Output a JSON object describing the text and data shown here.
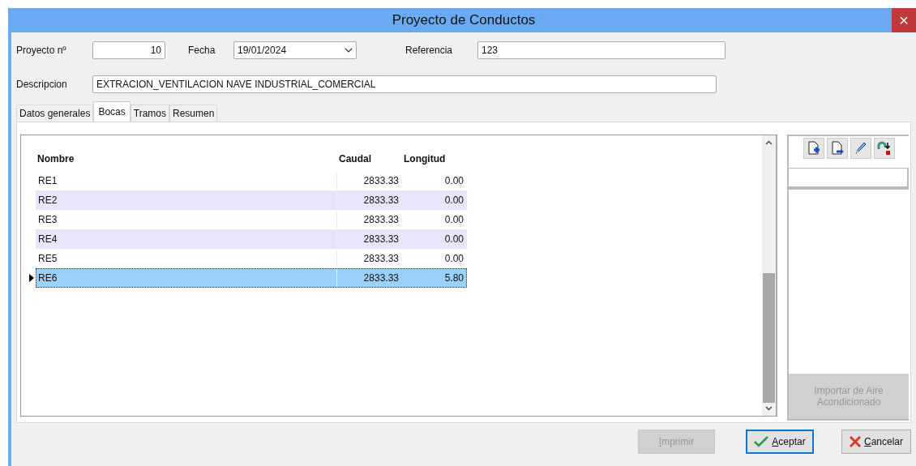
{
  "window": {
    "title": "Proyecto de Conductos",
    "close": "×"
  },
  "fields": [
    {
      "label": "Proyecto nº",
      "value": "10",
      "kind": "number"
    },
    {
      "label": "Fecha",
      "value": "19/01/2024",
      "kind": "date"
    },
    {
      "label": "Referencia",
      "value": "123",
      "kind": "text"
    }
  ],
  "description": {
    "label": "Descripcion",
    "value": "EXTRACION_VENTILACION NAVE INDUSTRIAL_COMERCIAL"
  },
  "tabs": [
    {
      "label": "Datos generales",
      "selected": false
    },
    {
      "label": "Bocas",
      "selected": true
    },
    {
      "label": "Tramos",
      "selected": false
    },
    {
      "label": "Resumen",
      "selected": false
    }
  ],
  "table": {
    "columns": [
      "Nombre",
      "Caudal",
      "Longitud"
    ],
    "rows": [
      {
        "cells": [
          "RE1",
          "2833.33",
          "0.00"
        ],
        "selected": false
      },
      {
        "cells": [
          "RE2",
          "2833.33",
          "0.00"
        ],
        "selected": false
      },
      {
        "cells": [
          "RE3",
          "2833.33",
          "0.00"
        ],
        "selected": false
      },
      {
        "cells": [
          "RE4",
          "2833.33",
          "0.00"
        ],
        "selected": false
      },
      {
        "cells": [
          "RE5",
          "2833.33",
          "0.00"
        ],
        "selected": false
      },
      {
        "cells": [
          "RE6",
          "2833.33",
          "5.80"
        ],
        "selected": true
      }
    ]
  },
  "side_panel": {
    "import_button": {
      "label": "Importar de Aire Acondicionado",
      "disabled": true
    }
  },
  "buttons": [
    {
      "label": "Imprimir",
      "kind": "print",
      "disabled": true
    },
    {
      "label": "Aceptar",
      "kind": "ok",
      "disabled": false
    },
    {
      "label": "Cancelar",
      "kind": "cancel",
      "disabled": false
    }
  ]
}
